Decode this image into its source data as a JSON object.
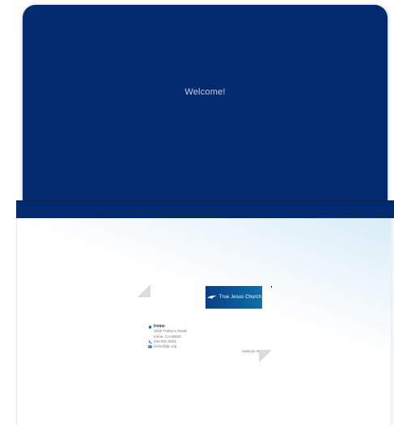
{
  "flap": {
    "welcome_text": "Welcome!"
  },
  "card": {
    "logo_text": "True Jesus Church",
    "city": "Irvine",
    "address_line1": "3200 Trabuco Road",
    "address_line2": "Irvine, CA 92620",
    "phone": "949.551.0001",
    "email": "irvine@tjc.org",
    "website": "www.tjc.org"
  },
  "icons": [
    "home-icon",
    "phone-icon",
    "mail-icon",
    "dove-logo-icon"
  ],
  "colors": {
    "navy": "#022b6f",
    "teal": "#0e6fa8",
    "card_icon": "#1f6aa8"
  }
}
